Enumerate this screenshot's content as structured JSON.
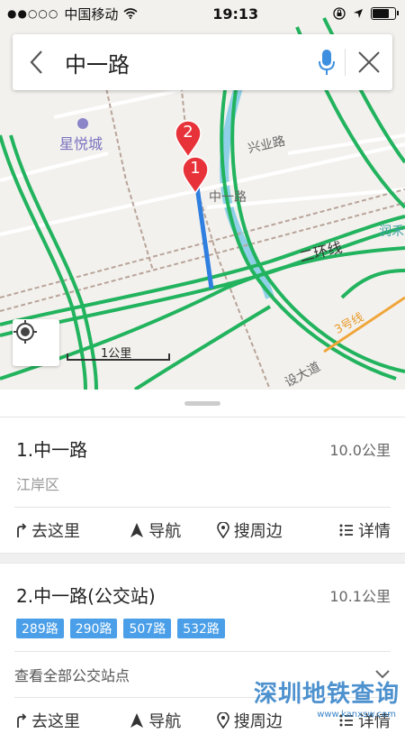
{
  "statusbar": {
    "carrier": "中国移动",
    "time": "19:13"
  },
  "search": {
    "query": "中一路"
  },
  "map": {
    "labels": {
      "xingyuecheng": "星悦城",
      "xingye_road": "兴业路",
      "zhongyi_road": "中一路",
      "ring2": "二环线",
      "line3": "3号线",
      "avenue": "设大道",
      "runhe": "润禾"
    },
    "markers": [
      "1",
      "2"
    ],
    "scale": "1公里"
  },
  "results": [
    {
      "title": "1.中一路",
      "distance": "10.0公里",
      "district": "江岸区",
      "actions": {
        "go": "去这里",
        "nav": "导航",
        "around": "搜周边",
        "detail": "详情"
      }
    },
    {
      "title": "2.中一路(公交站)",
      "distance": "10.1公里",
      "bus_lines": [
        "289路",
        "290路",
        "507路",
        "532路"
      ],
      "all_stops": "查看全部公交站点",
      "actions": {
        "go": "去这里",
        "nav": "导航",
        "around": "搜周边",
        "detail": "详情"
      }
    }
  ],
  "watermark": {
    "text": "深圳地铁查询",
    "url": "www.kanxsw.com"
  },
  "colors": {
    "accent": "#3d8fe0",
    "road_green": "#22b35e",
    "marker_red": "#e8323a",
    "route_blue": "#2f7fe0"
  }
}
